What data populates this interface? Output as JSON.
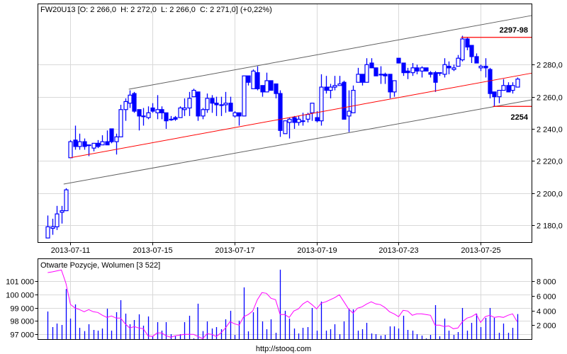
{
  "chart_data": [
    {
      "type": "candlestick",
      "title": "FW20U13 [O: 2 266,0  H: 2 272,0  L: 2 266,0  C: 2 271,0] (+0,22%)",
      "ylim": [
        2170,
        2310
      ],
      "yticks": [
        2180,
        2200,
        2220,
        2240,
        2260,
        2280
      ],
      "ytick_labels": [
        "2 180,0",
        "2 200,0",
        "2 220,0",
        "2 240,0",
        "2 260,0",
        "2 280,0"
      ],
      "xticks": [
        {
          "bar": 6,
          "label": "2013-07-11"
        },
        {
          "bar": 24,
          "label": "2013-07-15"
        },
        {
          "bar": 42,
          "label": "2013-07-17"
        },
        {
          "bar": 60,
          "label": "2013-07-19"
        },
        {
          "bar": 78,
          "label": "2013-07-23"
        },
        {
          "bar": 96,
          "label": "2013-07-25"
        }
      ],
      "ohlc": [
        [
          2172,
          2186,
          2172,
          2179
        ],
        [
          2178,
          2184,
          2174,
          2179
        ],
        [
          2179,
          2192,
          2177,
          2187
        ],
        [
          2188,
          2192,
          2181,
          2189
        ],
        [
          2189,
          2203,
          2189,
          2202
        ],
        [
          2222,
          2233,
          2222,
          2232
        ],
        [
          2233,
          2242,
          2227,
          2229
        ],
        [
          2229,
          2237,
          2227,
          2232
        ],
        [
          2232,
          2234,
          2227,
          2229
        ],
        [
          2230,
          2230,
          2223,
          2230
        ],
        [
          2228,
          2231,
          2226,
          2231
        ],
        [
          2231,
          2233,
          2228,
          2229
        ],
        [
          2230,
          2236,
          2230,
          2232
        ],
        [
          2232,
          2239,
          2230,
          2230
        ],
        [
          2240,
          2240,
          2231,
          2232
        ],
        [
          2232,
          2237,
          2224,
          2235
        ],
        [
          2235,
          2255,
          2235,
          2252
        ],
        [
          2252,
          2259,
          2245,
          2257
        ],
        [
          2256,
          2264,
          2253,
          2261
        ],
        [
          2262,
          2263,
          2250,
          2251
        ],
        [
          2252,
          2252,
          2239,
          2248
        ],
        [
          2248,
          2253,
          2242,
          2248
        ],
        [
          2247,
          2254,
          2246,
          2250
        ],
        [
          2253,
          2256,
          2250,
          2251
        ],
        [
          2250,
          2261,
          2246,
          2252
        ],
        [
          2252,
          2254,
          2246,
          2250
        ],
        [
          2250,
          2250,
          2240,
          2245
        ],
        [
          2246,
          2248,
          2245,
          2246
        ],
        [
          2247,
          2248,
          2245,
          2246
        ],
        [
          2247,
          2254,
          2247,
          2253
        ],
        [
          2252,
          2259,
          2248,
          2253
        ],
        [
          2253,
          2263,
          2248,
          2259
        ],
        [
          2260,
          2265,
          2260,
          2264
        ],
        [
          2263,
          2263,
          2245,
          2248
        ],
        [
          2248,
          2253,
          2246,
          2252
        ],
        [
          2252,
          2262,
          2250,
          2259
        ],
        [
          2259,
          2261,
          2250,
          2256
        ],
        [
          2256,
          2260,
          2248,
          2255
        ],
        [
          2255,
          2260,
          2248,
          2255
        ],
        [
          2255,
          2263,
          2250,
          2256
        ],
        [
          2256,
          2260,
          2251,
          2251
        ],
        [
          2248,
          2251,
          2247,
          2250
        ],
        [
          2250,
          2250,
          2242,
          2248
        ],
        [
          2248,
          2273,
          2248,
          2273
        ],
        [
          2273,
          2273,
          2267,
          2269
        ],
        [
          2265,
          2277,
          2265,
          2276
        ],
        [
          2275,
          2279,
          2264,
          2265
        ],
        [
          2267,
          2267,
          2260,
          2263
        ],
        [
          2263,
          2275,
          2263,
          2270
        ],
        [
          2270,
          2270,
          2264,
          2264
        ],
        [
          2268,
          2268,
          2259,
          2262
        ],
        [
          2262,
          2264,
          2235,
          2239
        ],
        [
          2237,
          2245,
          2237,
          2245
        ],
        [
          2244,
          2247,
          2234,
          2246
        ],
        [
          2247,
          2248,
          2240,
          2244
        ],
        [
          2244,
          2248,
          2242,
          2246
        ],
        [
          2245,
          2250,
          2242,
          2245
        ],
        [
          2246,
          2250,
          2244,
          2249
        ],
        [
          2250,
          2256,
          2245,
          2256
        ],
        [
          2247,
          2251,
          2244,
          2245
        ],
        [
          2245,
          2274,
          2242,
          2266
        ],
        [
          2266,
          2273,
          2262,
          2264
        ],
        [
          2264,
          2268,
          2259,
          2266
        ],
        [
          2266,
          2273,
          2264,
          2267
        ],
        [
          2267,
          2273,
          2267,
          2268
        ],
        [
          2269,
          2270,
          2246,
          2246
        ],
        [
          2248,
          2264,
          2238,
          2251
        ],
        [
          2250,
          2267,
          2250,
          2264
        ],
        [
          2269,
          2278,
          2269,
          2274
        ],
        [
          2274,
          2274,
          2267,
          2269
        ],
        [
          2269,
          2284,
          2269,
          2280
        ],
        [
          2281,
          2284,
          2278,
          2278
        ],
        [
          2278,
          2278,
          2273,
          2273
        ],
        [
          2274,
          2279,
          2268,
          2274
        ],
        [
          2274,
          2275,
          2268,
          2273
        ],
        [
          2274,
          2274,
          2259,
          2263
        ],
        [
          2263,
          2270,
          2260,
          2270
        ],
        [
          2284,
          2284,
          2281,
          2281
        ],
        [
          2281,
          2281,
          2273,
          2275
        ],
        [
          2276,
          2278,
          2271,
          2275
        ],
        [
          2275,
          2281,
          2273,
          2278
        ],
        [
          2278,
          2280,
          2274,
          2276
        ],
        [
          2276,
          2279,
          2272,
          2278
        ],
        [
          2278,
          2278,
          2276,
          2276
        ],
        [
          2275,
          2276,
          2272,
          2274
        ],
        [
          2275,
          2276,
          2263,
          2269
        ],
        [
          2275,
          2275,
          2273,
          2275
        ],
        [
          2274,
          2284,
          2272,
          2280
        ],
        [
          2279,
          2282,
          2274,
          2278
        ],
        [
          2277,
          2280,
          2276,
          2278
        ],
        [
          2279,
          2286,
          2279,
          2284
        ],
        [
          2283,
          2298,
          2282,
          2296
        ],
        [
          2296,
          2297,
          2289,
          2291
        ],
        [
          2292,
          2292,
          2281,
          2285
        ],
        [
          2285,
          2287,
          2281,
          2281
        ],
        [
          2278,
          2280,
          2276,
          2279
        ],
        [
          2279,
          2284,
          2272,
          2278
        ],
        [
          2277,
          2278,
          2259,
          2262
        ],
        [
          2263,
          2263,
          2254,
          2260
        ],
        [
          2260,
          2264,
          2256,
          2264
        ],
        [
          2264,
          2271,
          2264,
          2267
        ],
        [
          2267,
          2269,
          2263,
          2263
        ],
        [
          2264,
          2269,
          2262,
          2267
        ],
        [
          2266,
          2272,
          2266,
          2271
        ]
      ],
      "trendlines": [
        {
          "name": "regression",
          "color": "#ff0000",
          "from": [
            6,
            2222
          ],
          "to": [
            107.2,
            2274.7
          ]
        },
        {
          "name": "upper-channel",
          "color": "#606060",
          "from": [
            18.8,
            2264.7
          ],
          "to": [
            107.2,
            2310.6
          ]
        },
        {
          "name": "lower-channel",
          "color": "#606060",
          "from": [
            4.5,
            2205.6
          ],
          "to": [
            107.2,
            2258.1
          ]
        }
      ],
      "levels": [
        {
          "label": "2297-98",
          "price": 2297,
          "from_bar": 92,
          "color": "#ff0000"
        },
        {
          "label": "2254",
          "price": 2254,
          "from_bar": 99,
          "color": "#ff0000"
        }
      ],
      "colors": {
        "candle": "#0000ff",
        "grid": "#d9d9d9"
      }
    },
    {
      "type": "bar+line",
      "title": "Otwarte Pozycje, Wolumen [3 522]",
      "left_axis": {
        "label": "Otwarte Pozycje",
        "ticks": [
          97000,
          98000,
          99000,
          100000,
          101000
        ],
        "tick_labels": [
          "97 000",
          "98 000",
          "99 000",
          "100 000",
          "101 000"
        ]
      },
      "right_axis": {
        "label": "Wolumen",
        "ticks": [
          2000,
          4000,
          6000,
          8000
        ],
        "tick_labels": [
          "2 000",
          "4 000",
          "6 000",
          "8 000"
        ]
      },
      "volume": [
        3876,
        1744,
        2229,
        2035,
        6945,
        2907,
        4845,
        1647,
        1195,
        2132,
        1357,
        1260,
        1550,
        4264,
        1260,
        3779,
        5426,
        3585,
        2132,
        2713,
        3488,
        1938,
        3198,
        485,
        2423,
        1260,
        2423,
        775,
        485,
        775,
        2423,
        3295,
        200,
        4942,
        1195,
        2519,
        1550,
        1744,
        1453,
        2810,
        3973,
        678,
        2616,
        7171,
        1163,
        3779,
        4457,
        2519,
        1453,
        2810,
        969,
        9593,
        3973,
        2907,
        1550,
        872,
        1647,
        1744,
        4360,
        1260,
        5233,
        1260,
        1453,
        2132,
        775,
        2519,
        4264,
        4167,
        1260,
        1453,
        2326,
        872,
        775,
        581,
        678,
        1841,
        1841,
        1550,
        3295,
        1357,
        1260,
        775,
        581,
        194,
        678,
        4748,
        485,
        2907,
        1260,
        678,
        1066,
        4360,
        1260,
        2326,
        3585,
        1744,
        3004,
        4360,
        3004,
        969,
        2229,
        969,
        1647,
        3522
      ],
      "open_interest": [
        101661,
        101714,
        101786,
        101857,
        100857,
        99250,
        98982,
        98857,
        98696,
        98857,
        98696,
        98643,
        98429,
        98268,
        98375,
        98214,
        98214,
        97786,
        97464,
        97571,
        97464,
        97411,
        96875,
        96821,
        97089,
        97089,
        96875,
        96768,
        96875,
        96929,
        96982,
        96982,
        96982,
        96821,
        96661,
        97036,
        96982,
        96821,
        97089,
        97464,
        97946,
        97786,
        97679,
        98321,
        98482,
        98750,
        99607,
        100143,
        100089,
        99714,
        99607,
        98482,
        98482,
        98268,
        98750,
        98911,
        99286,
        99500,
        99232,
        98911,
        99339,
        99446,
        99607,
        99768,
        99982,
        99446,
        98911,
        98589,
        98964,
        99071,
        99286,
        99446,
        99286,
        99232,
        99018,
        98696,
        98536,
        98321,
        98804,
        98750,
        98429,
        98536,
        98536,
        98482,
        98429,
        97679,
        97679,
        97571,
        97625,
        97411,
        97464,
        97946,
        98214,
        98321,
        98536,
        97893,
        98321,
        98429,
        98268,
        98321,
        98268,
        98429,
        98536,
        97946
      ],
      "colors": {
        "volume": "#0000ff",
        "open_interest": "#ff00ff"
      }
    }
  ],
  "footer": {
    "source": "http://stooq.com"
  }
}
